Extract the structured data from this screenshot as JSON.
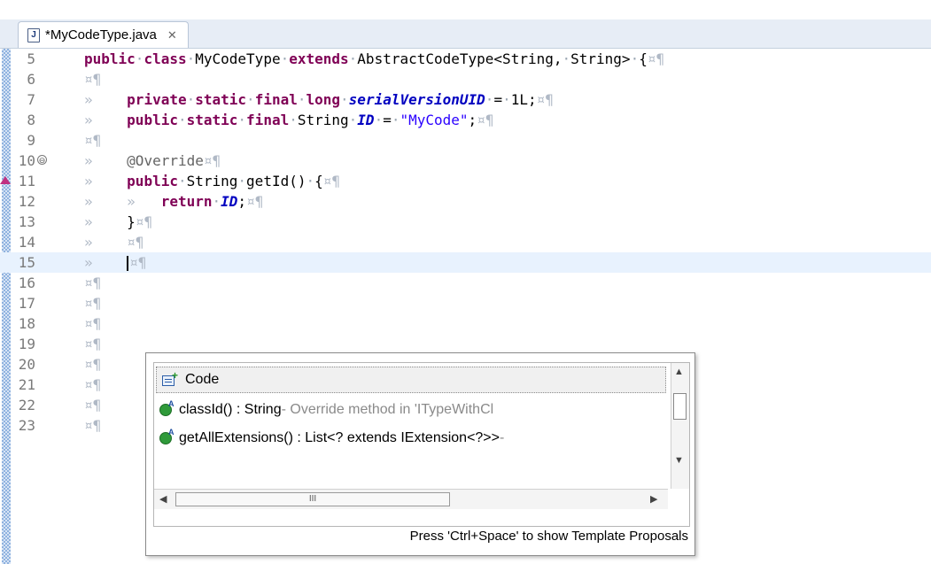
{
  "tab": {
    "label": "*MyCodeType.java",
    "icon_letter": "J",
    "close_glyph": "✕"
  },
  "editor": {
    "lines": [
      {
        "num": "5"
      },
      {
        "num": "6"
      },
      {
        "num": "7"
      },
      {
        "num": "8"
      },
      {
        "num": "9"
      },
      {
        "num": "10"
      },
      {
        "num": "11"
      },
      {
        "num": "12"
      },
      {
        "num": "13"
      },
      {
        "num": "14"
      },
      {
        "num": "15"
      },
      {
        "num": "16"
      },
      {
        "num": "17"
      },
      {
        "num": "18"
      },
      {
        "num": "19"
      },
      {
        "num": "20"
      },
      {
        "num": "21"
      },
      {
        "num": "22"
      },
      {
        "num": "23"
      }
    ],
    "tokens": {
      "public": "public",
      "class": "class",
      "class_name": "MyCodeType",
      "extends": "extends",
      "super_type": "AbstractCodeType<String,",
      "super_type2": "String>",
      "open_brace": "{",
      "private": "private",
      "static": "static",
      "final": "final",
      "long": "long",
      "serial_field": "serialVersionUID",
      "eq": "=",
      "serial_value": "1L;",
      "string_type": "String",
      "id_field": "ID",
      "id_value": "\"MyCode\"",
      "semicolon": ";",
      "override": "@Override",
      "method_sig": "getId()",
      "return": "return",
      "id_ref": "ID",
      "close_brace": "}"
    },
    "markers": {
      "tab": "»",
      "ws_end": "¤¶",
      "dot": "·",
      "fold": "⊖"
    }
  },
  "proposals": {
    "category": "Code",
    "items": [
      {
        "name": "classId() : String",
        "detail": " - Override method in 'ITypeWithCl"
      },
      {
        "name": "getAllExtensions() : List<? extends IExtension<?>>",
        "detail": " -"
      }
    ],
    "hthumb_grip": "III",
    "arrow_up": "▲",
    "arrow_down": "▼",
    "arrow_left": "◀",
    "arrow_right": "▶",
    "footer": "Press 'Ctrl+Space' to show Template Proposals"
  },
  "colors": {
    "keyword": "#7f0055",
    "field": "#0000c0",
    "string": "#2a00ff",
    "current_line": "#e8f2fe"
  }
}
